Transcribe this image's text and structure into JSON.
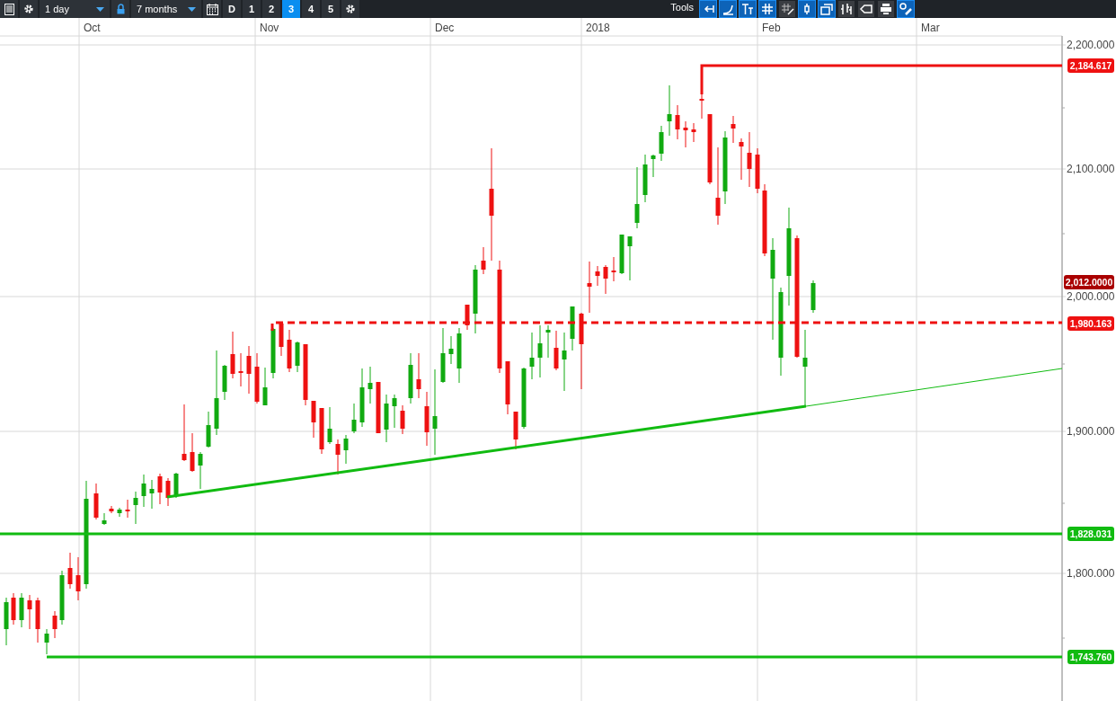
{
  "toolbar": {
    "interval": "1 day",
    "range": "7 months",
    "range_locked": true,
    "views": [
      {
        "label": "D",
        "selected": false
      },
      {
        "label": "1",
        "selected": false
      },
      {
        "label": "2",
        "selected": false
      },
      {
        "label": "3",
        "selected": true
      },
      {
        "label": "4",
        "selected": false
      },
      {
        "label": "5",
        "selected": false
      }
    ],
    "tools_label": "Tools",
    "tools": [
      {
        "kind": "back",
        "selected": true
      },
      {
        "kind": "curve",
        "selected": true
      },
      {
        "kind": "text",
        "selected": true
      },
      {
        "kind": "grid",
        "selected": true
      },
      {
        "kind": "grid-pencil",
        "selected": false
      },
      {
        "kind": "candle",
        "selected": true
      },
      {
        "kind": "windows",
        "selected": true
      },
      {
        "kind": "bars",
        "selected": false
      },
      {
        "kind": "tag",
        "selected": false
      },
      {
        "kind": "print",
        "selected": false
      },
      {
        "kind": "settings",
        "selected": true
      }
    ]
  },
  "chart": {
    "months": [
      "Oct",
      "Nov",
      "Dec",
      "2018",
      "Feb",
      "Mar"
    ],
    "price_ticks": [
      "2,200.000",
      "2,100.000",
      "2,000.000",
      "1,900.000",
      "1,800.000"
    ],
    "price_badges": [
      {
        "label": "2,184.617",
        "color": "#ee1111"
      },
      {
        "label": "2,012.0000",
        "color": "#aa0000"
      },
      {
        "label": "1,980.163",
        "color": "#ee1111"
      },
      {
        "label": "1,828.031",
        "color": "#11bb11"
      },
      {
        "label": "1,743.760",
        "color": "#11bb11"
      }
    ]
  }
}
